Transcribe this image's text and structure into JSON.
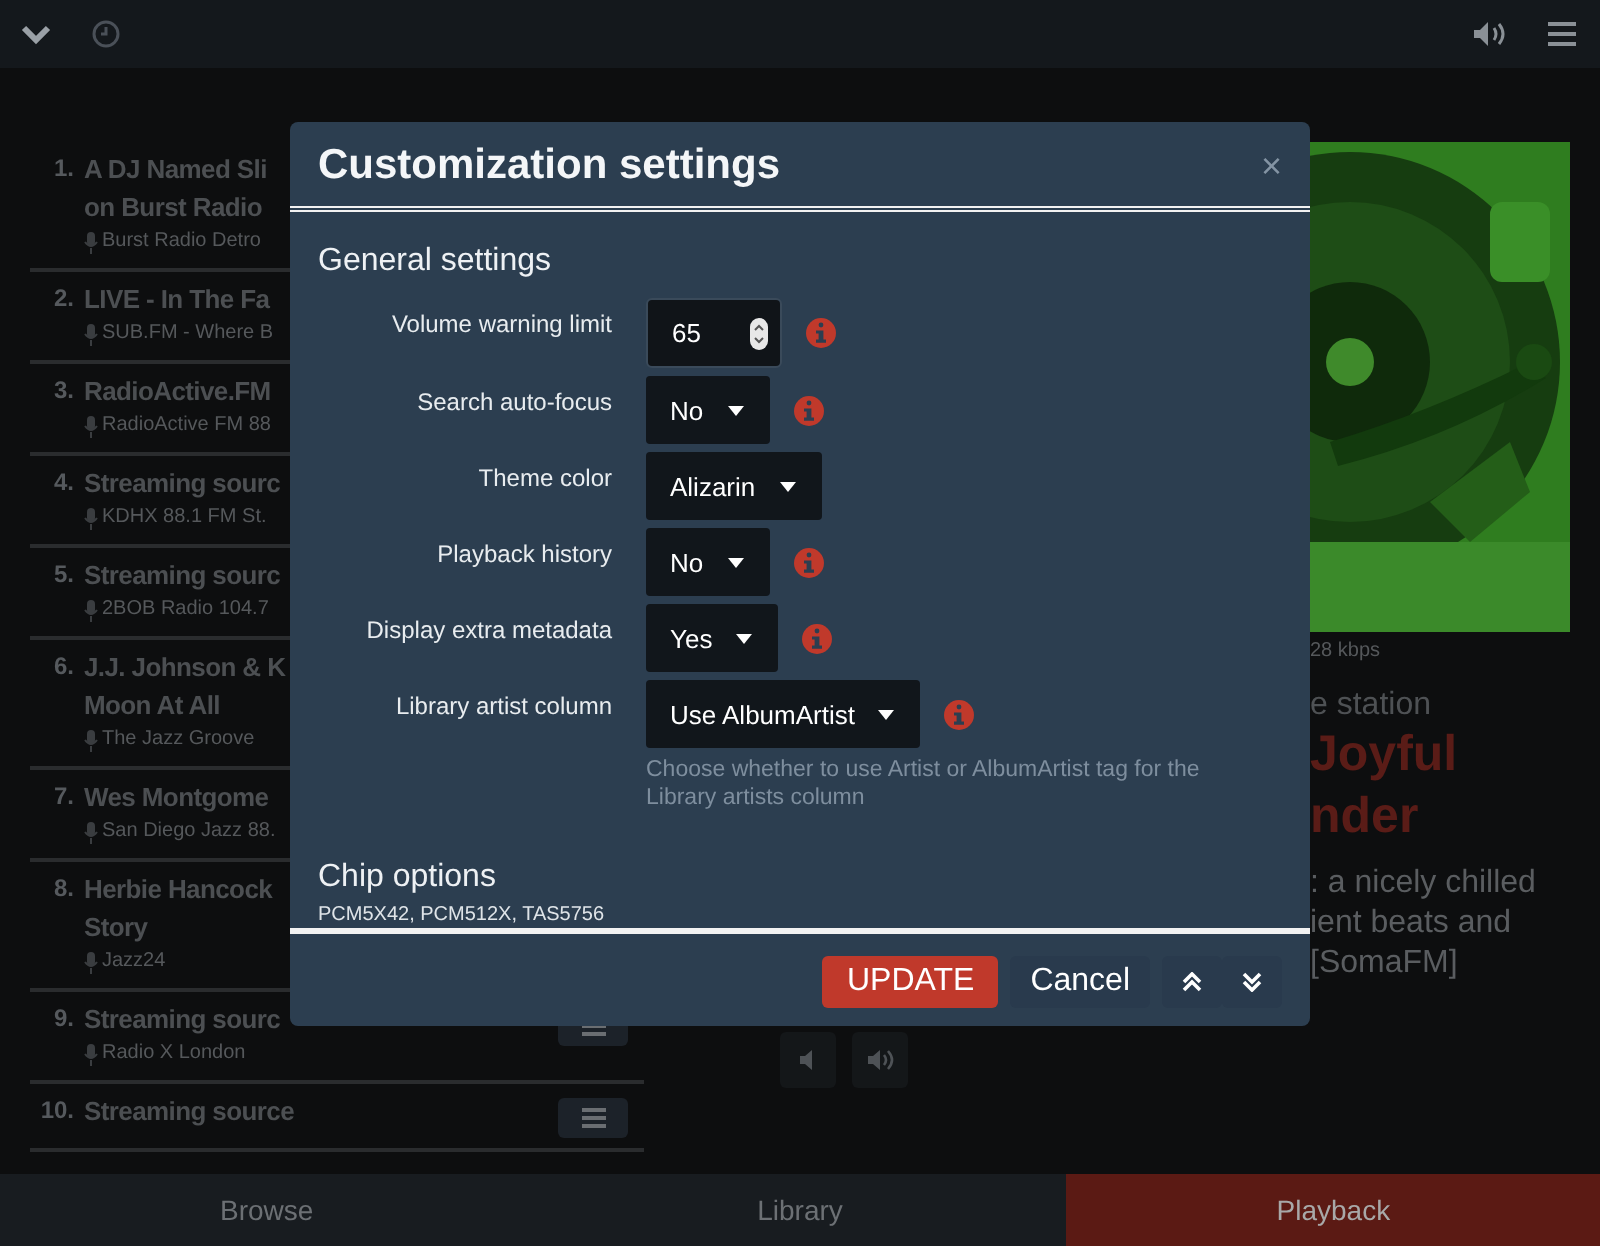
{
  "queue": [
    {
      "number": "1.",
      "title_lines": [
        "A DJ Named Sli",
        "on Burst Radio"
      ],
      "station": "Burst Radio Detro",
      "has_menu": false
    },
    {
      "number": "2.",
      "title_lines": [
        "LIVE - In The Fa"
      ],
      "station": "SUB.FM - Where B",
      "has_menu": false
    },
    {
      "number": "3.",
      "title_lines": [
        "RadioActive.FM"
      ],
      "station": "RadioActive FM 88",
      "has_menu": false
    },
    {
      "number": "4.",
      "title_lines": [
        "Streaming sourc"
      ],
      "station": "KDHX 88.1 FM St.",
      "has_menu": false
    },
    {
      "number": "5.",
      "title_lines": [
        "Streaming sourc"
      ],
      "station": "2BOB Radio 104.7",
      "has_menu": false
    },
    {
      "number": "6.",
      "title_lines": [
        "J.J. Johnson & K",
        "Moon At All"
      ],
      "station": "The Jazz Groove",
      "has_menu": false
    },
    {
      "number": "7.",
      "title_lines": [
        "Wes Montgome"
      ],
      "station": "San Diego Jazz 88.",
      "has_menu": false
    },
    {
      "number": "8.",
      "title_lines": [
        "Herbie Hancock",
        "Story"
      ],
      "station": "Jazz24",
      "has_menu": false
    },
    {
      "number": "9.",
      "title_lines": [
        "Streaming sourc"
      ],
      "station": "Radio X London",
      "has_menu": true
    },
    {
      "number": "10.",
      "title_lines": [
        "Streaming source"
      ],
      "has_menu": true
    }
  ],
  "now_playing": {
    "bitrate": "28 kbps",
    "lines": [
      {
        "kind": "subtitle",
        "text": "e station"
      },
      {
        "kind": "title",
        "text": "Joyful"
      },
      {
        "kind": "title",
        "text": "nder"
      },
      {
        "kind": "description",
        "text": ": a nicely chilled"
      },
      {
        "kind": "description",
        "text": "ient beats and"
      },
      {
        "kind": "description",
        "text": "[SomaFM]"
      }
    ]
  },
  "dialog": {
    "title": "Customization settings",
    "close": "×",
    "sections": [
      {
        "heading": "General settings",
        "fields": [
          {
            "kind": "number",
            "label": "Volume warning limit",
            "value": "65",
            "info": true
          },
          {
            "kind": "select",
            "label": "Search auto-focus",
            "value": "No",
            "info": true
          },
          {
            "kind": "select",
            "label": "Theme color",
            "value": "Alizarin",
            "info": false
          },
          {
            "kind": "select",
            "label": "Playback history",
            "value": "No",
            "info": true
          },
          {
            "kind": "select",
            "label": "Display extra metadata",
            "value": "Yes",
            "info": true
          },
          {
            "kind": "select",
            "label": "Library artist column",
            "value": "Use AlbumArtist",
            "info": true,
            "help": "Choose whether to use Artist or AlbumArtist tag for the Library artists column"
          }
        ]
      },
      {
        "heading": "Chip options",
        "text": "PCM5X42, PCM512X, TAS5756"
      }
    ],
    "buttons": [
      {
        "kind": "primary",
        "label": "UPDATE"
      },
      {
        "kind": "secondary",
        "label": "Cancel"
      },
      {
        "kind": "up"
      },
      {
        "kind": "down"
      }
    ]
  },
  "nav": [
    {
      "label": "Browse",
      "selected": false
    },
    {
      "label": "Library",
      "selected": false
    },
    {
      "label": "Playback",
      "selected": true
    }
  ]
}
